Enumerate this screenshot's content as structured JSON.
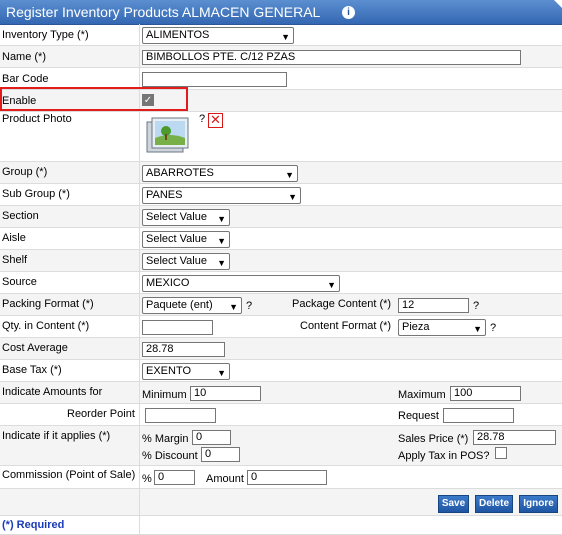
{
  "title": "Register Inventory Products ALMACEN GENERAL",
  "fields": {
    "inventory_type": {
      "label": "Inventory Type (*)",
      "value": "ALIMENTOS"
    },
    "name": {
      "label": "Name (*)",
      "value": "BIMBOLLOS PTE. C/12 PZAS"
    },
    "bar_code": {
      "label": "Bar Code",
      "value": ""
    },
    "enable": {
      "label": "Enable",
      "checked": true
    },
    "product_photo": {
      "label": "Product Photo",
      "help": "?"
    },
    "group": {
      "label": "Group (*)",
      "value": "ABARROTES"
    },
    "sub_group": {
      "label": "Sub Group (*)",
      "value": "PANES"
    },
    "section": {
      "label": "Section",
      "value": "Select Value"
    },
    "aisle": {
      "label": "Aisle",
      "value": "Select Value"
    },
    "shelf": {
      "label": "Shelf",
      "value": "Select Value"
    },
    "source": {
      "label": "Source",
      "value": "MEXICO"
    },
    "packing_format": {
      "label": "Packing Format (*)",
      "value": "Paquete (ent)",
      "help": "?"
    },
    "package_content": {
      "label": "Package Content (*)",
      "value": "12",
      "help": "?"
    },
    "qty_in_content": {
      "label": "Qty. in Content (*)",
      "value": ""
    },
    "content_format": {
      "label": "Content Format (*)",
      "value": "Pieza",
      "help": "?"
    },
    "cost_average": {
      "label": "Cost Average",
      "value": "28.78"
    },
    "base_tax": {
      "label": "Base Tax (*)",
      "value": "EXENTO"
    },
    "indicate_amounts": {
      "label": "Indicate Amounts for"
    },
    "minimum": {
      "label": "Minimum",
      "value": "10"
    },
    "maximum": {
      "label": "Maximum",
      "value": "100"
    },
    "reorder_point": {
      "label": "Reorder Point",
      "value": ""
    },
    "request": {
      "label": "Request",
      "value": ""
    },
    "indicate_applies": {
      "label": "Indicate if it applies (*)"
    },
    "margin": {
      "label": "% Margin",
      "value": "0"
    },
    "discount": {
      "label": "% Discount",
      "value": "0"
    },
    "sales_price": {
      "label": "Sales Price (*)",
      "value": "28.78"
    },
    "apply_tax_pos": {
      "label": "Apply Tax in POS?",
      "checked": false
    },
    "commission": {
      "label": "Commission (Point of Sale)"
    },
    "commission_pct": {
      "label": "%",
      "value": "0"
    },
    "amount": {
      "label": "Amount",
      "value": "0"
    }
  },
  "buttons": {
    "save": "Save",
    "delete": "Delete",
    "ignore": "Ignore"
  },
  "footer": {
    "required": "(*) Required"
  },
  "colors": {
    "header": "#3467b2",
    "highlight": "#e21b1b",
    "button": "#1f56a3",
    "required": "#1a3bb8"
  }
}
